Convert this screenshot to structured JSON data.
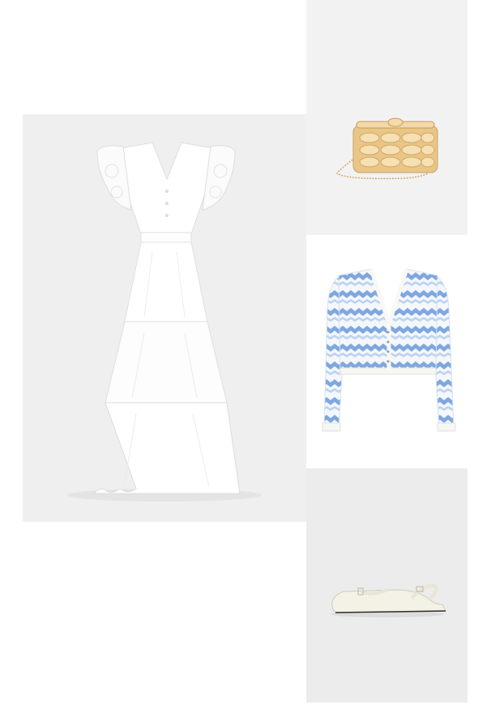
{
  "outfit": {
    "items": [
      {
        "id": "dress",
        "icon": "white-tiered-midi-dress-image"
      },
      {
        "id": "clutch",
        "icon": "gold-metal-clutch-bag-image"
      },
      {
        "id": "cardigan",
        "icon": "blue-wave-knit-cardigan-image"
      },
      {
        "id": "flats",
        "icon": "cream-slingback-flats-image"
      }
    ]
  },
  "colors": {
    "dress_bg": "#efefef",
    "clutch_bg": "#f2f2f2",
    "cardigan_bg": "#ffffff",
    "flats_bg": "#ececec",
    "gold": "#e7c27f",
    "blue": "#8fb3e6",
    "cream": "#f4f1e7"
  }
}
